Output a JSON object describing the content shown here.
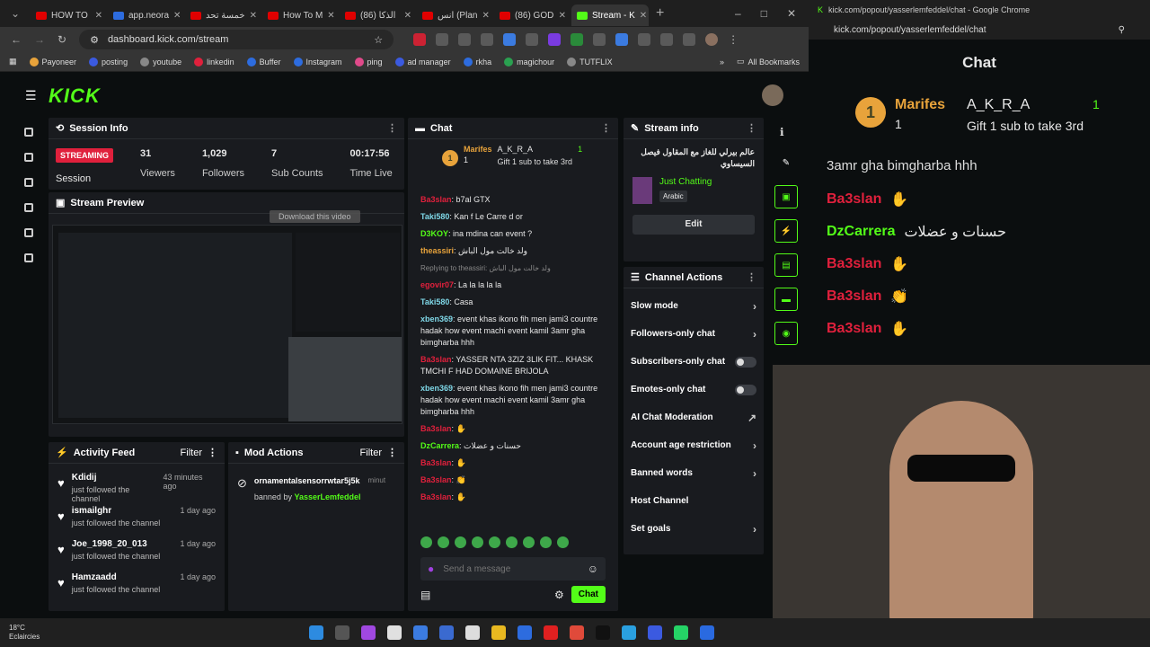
{
  "browser": {
    "tabs": [
      {
        "label": "HOW TO ",
        "color": "#e00000"
      },
      {
        "label": "app.neora",
        "color": "#2d6cdf"
      },
      {
        "label": "خمسة تحد",
        "color": "#e00000"
      },
      {
        "label": "How To M",
        "color": "#e00000"
      },
      {
        "label": "الذكا (86)",
        "color": "#e00000"
      },
      {
        "label": "انس (Plan",
        "color": "#e00000"
      },
      {
        "label": "(86) GOD",
        "color": "#e00000"
      },
      {
        "label": "Stream - K",
        "color": "#53fc18"
      }
    ],
    "url": "dashboard.kick.com/stream",
    "bookmarks": [
      "Payoneer",
      "posting",
      "youtube",
      "linkedin",
      "Buffer",
      "Instagram",
      "ping",
      "ad manager",
      "rkha",
      "magichour",
      "TUTFLIX"
    ],
    "all_bookmarks": "All Bookmarks"
  },
  "kick": {
    "logo": "KICK",
    "session": {
      "title": "Session Info",
      "status": "STREAMING",
      "status_caption": "Session",
      "viewers": "31",
      "viewers_label": "Viewers",
      "followers": "1,029",
      "followers_label": "Followers",
      "subs": "7",
      "subs_label": "Sub Counts",
      "time": "00:17:56",
      "time_label": "Time Live"
    },
    "preview": {
      "title": "Stream Preview",
      "download": "Download this video"
    },
    "activity": {
      "title": "Activity Feed",
      "filter": "Filter",
      "items": [
        {
          "name": "Kdidij",
          "action": "just followed the channel",
          "time": "43 minutes ago"
        },
        {
          "name": "ismailghr",
          "action": "just followed the channel",
          "time": "1 day ago"
        },
        {
          "name": "Joe_1998_20_013",
          "action": "just followed the channel",
          "time": "1 day ago"
        },
        {
          "name": "Hamzaadd",
          "action": "just followed the channel",
          "time": "1 day ago"
        }
      ]
    },
    "mod": {
      "title": "Mod Actions",
      "filter": "Filter",
      "user": "ornamentalsensorrwtar5j5k",
      "banned_by": "banned by",
      "mod_name": "YasserLemfeddel",
      "time": "minut"
    },
    "chat": {
      "title": "Chat",
      "leaders": {
        "first": "Marifes",
        "first_count": "1",
        "second": "A_K_R_A",
        "second_count": "1",
        "gift": "Gift 1 sub to take 3rd"
      },
      "messages": [
        {
          "user": "Ba3slan",
          "color": "#e0203c",
          "text": "b7al GTX"
        },
        {
          "user": "Taki580",
          "color": "#7fd8e8",
          "text": "Kan f Le Carre d or"
        },
        {
          "user": "D3KOY",
          "color": "#53fc18",
          "text": "ina mdina can event ?"
        },
        {
          "user": "theassiri",
          "color": "#e8a33b",
          "text": "ولد خالت مول الباش"
        },
        {
          "user": "egovir07",
          "color": "#e0203c",
          "text": "La la la la la"
        },
        {
          "user": "Taki580",
          "color": "#7fd8e8",
          "text": "Casa"
        },
        {
          "user": "xben369",
          "color": "#7fd8e8",
          "text": "event khas ikono fih men jami3 countre hadak how event machi event kamil 3amr gha bimgharba hhh"
        },
        {
          "user": "Ba3slan",
          "color": "#e0203c",
          "text": "YASSER NTA 3ZIZ 3LIK FIT... KHASK TMCHI F HAD DOMAINE BRIJOLA"
        },
        {
          "user": "xben369",
          "color": "#7fd8e8",
          "text": "event khas ikono fih men jami3 countre hadak how event machi event kamil 3amr gha bimgharba hhh"
        },
        {
          "user": "Ba3slan",
          "color": "#e0203c",
          "text": "✋"
        },
        {
          "user": "DzCarrera",
          "color": "#53fc18",
          "text": "حسنات و عضلات"
        },
        {
          "user": "Ba3slan",
          "color": "#e0203c",
          "text": "✋"
        },
        {
          "user": "Ba3slan",
          "color": "#e0203c",
          "text": "👏"
        },
        {
          "user": "Ba3slan",
          "color": "#e0203c",
          "text": "✋"
        }
      ],
      "reply_note": "Replying to theassiri: ولد خالت مول الباش",
      "placeholder": "Send a message",
      "send": "Chat"
    },
    "stream_info": {
      "title": "Stream info",
      "stream_title": "عالم بيرلي للغاز مع المقاول فيصل السيساوي",
      "category": "Just Chatting",
      "language": "Arabic",
      "edit": "Edit"
    },
    "channel_actions": {
      "title": "Channel Actions",
      "items": [
        "Slow mode",
        "Followers-only chat",
        "Subscribers-only chat",
        "Emotes-only chat",
        "AI Chat Moderation",
        "Account age restriction",
        "Banned words",
        "Host Channel",
        "Set goals"
      ]
    }
  },
  "popout": {
    "window_title": "kick.com/popout/yasserlemfeddel/chat - Google Chrome",
    "url": "kick.com/popout/yasserlemfeddel/chat",
    "title": "Chat",
    "leaders": {
      "first": "Marifes",
      "first_count": "1",
      "second": "A_K_R_A",
      "second_count": "1",
      "gift": "Gift 1 sub to take 3rd"
    },
    "partial": "3amr gha bimgharba hhh",
    "messages": [
      {
        "user": "Ba3slan",
        "text": "✋"
      },
      {
        "user": "DzCarrera",
        "text": "حسنات و عضلات"
      },
      {
        "user": "Ba3slan",
        "text": "✋"
      },
      {
        "user": "Ba3slan",
        "text": "👏"
      },
      {
        "user": "Ba3slan",
        "text": "✋"
      }
    ]
  },
  "taskbar": {
    "temp": "18°C",
    "weather": "Eclaircies"
  }
}
